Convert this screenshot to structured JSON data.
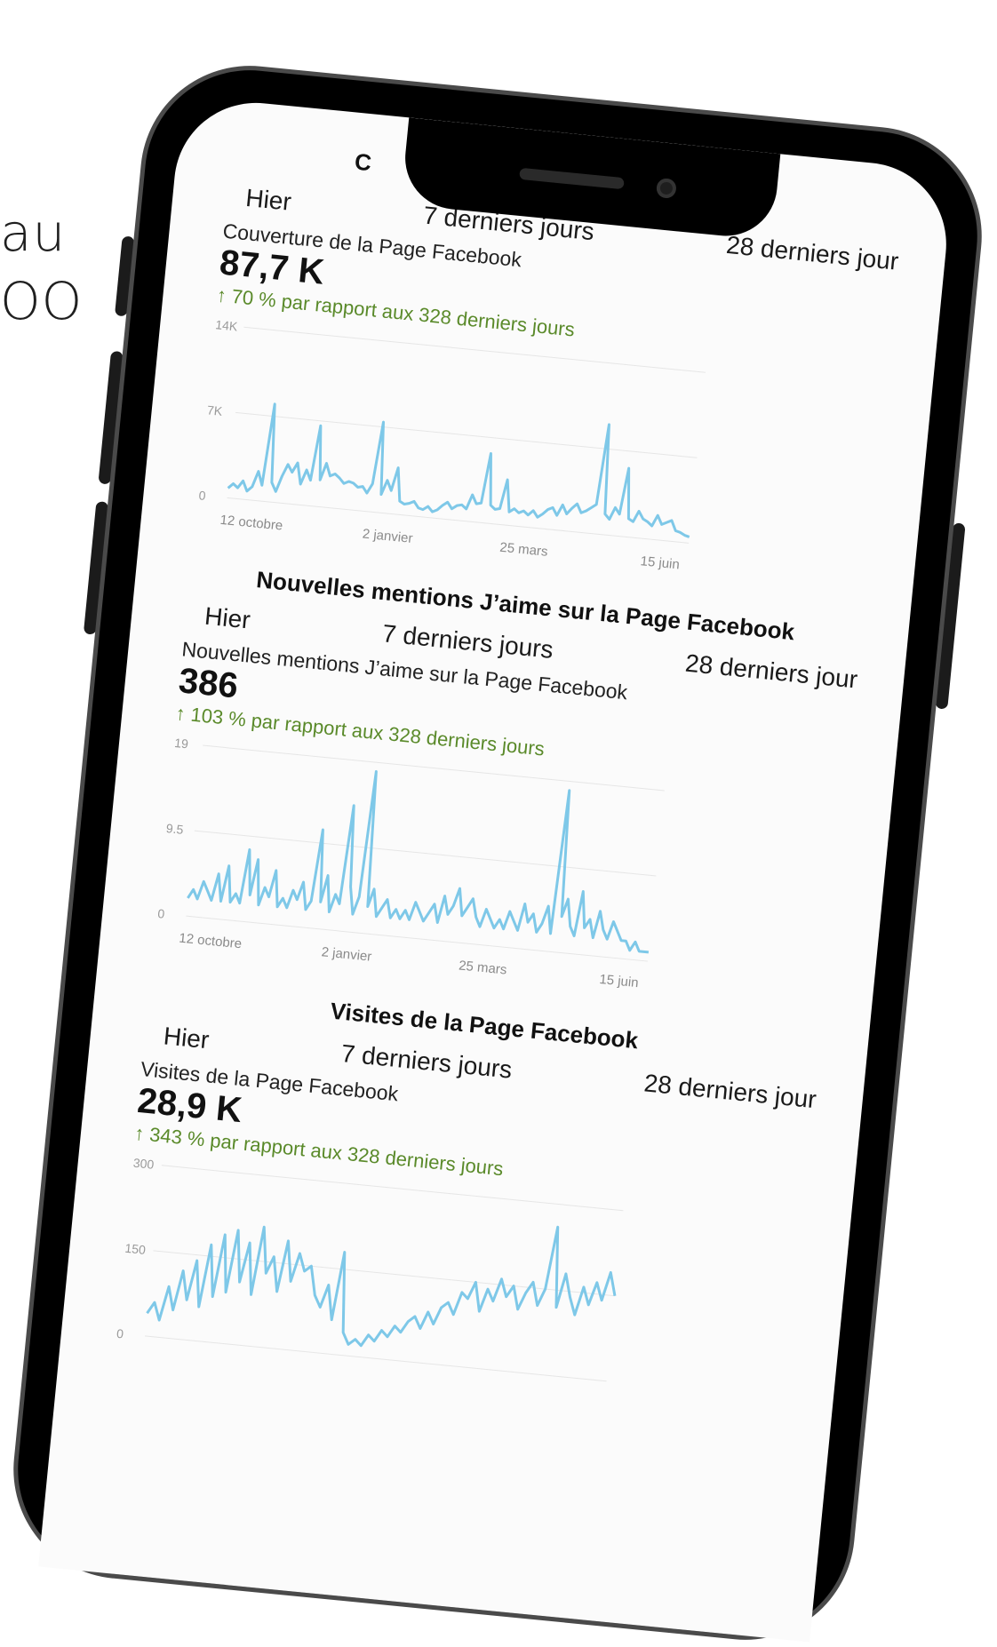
{
  "background": {
    "line1": "au",
    "line2": "OO"
  },
  "top_partial_title": "C",
  "sections": [
    {
      "title": "",
      "tabs": [
        "Hier",
        "7 derniers jours",
        "28 derniers jour"
      ],
      "metric_label": "Couverture de la Page Facebook",
      "metric_value": "87,7 K",
      "delta": "↑ 70 % par rapport aux 328 derniers jours",
      "chart_data": {
        "type": "line",
        "yticks": [
          "14K",
          "7K",
          "0"
        ],
        "ylim": [
          0,
          14000
        ],
        "xticks": [
          "12 octobre",
          "2 janvier",
          "25 mars",
          "15 juin"
        ],
        "color": "#7ec8e8",
        "values": [
          800,
          1200,
          900,
          1500,
          700,
          1100,
          2400,
          1300,
          8000,
          1600,
          900,
          2200,
          3200,
          2600,
          3400,
          1700,
          2900,
          2100,
          6600,
          2200,
          3600,
          2600,
          2800,
          2500,
          2100,
          2300,
          2200,
          1900,
          2000,
          1500,
          2300,
          7400,
          1500,
          2700,
          1900,
          3800,
          1100,
          900,
          1000,
          1200,
          700,
          600,
          900,
          500,
          700,
          1100,
          1400,
          900,
          1200,
          1300,
          1000,
          2200,
          1500,
          1600,
          5700,
          1500,
          1200,
          1300,
          3700,
          1100,
          1400,
          1100,
          1300,
          1000,
          1400,
          900,
          1200,
          1600,
          1800,
          1200,
          2100,
          1400,
          1900,
          2300,
          1600,
          1800,
          2100,
          2400,
          9000,
          1700,
          1300,
          2300,
          1800,
          5600,
          1500,
          1300,
          2200,
          1600,
          1400,
          1100,
          2000,
          1300,
          1500,
          1700,
          900,
          800,
          600,
          500
        ]
      }
    },
    {
      "title": "Nouvelles mentions J’aime sur la Page Facebook",
      "tabs": [
        "Hier",
        "7 derniers jours",
        "28 derniers jour"
      ],
      "metric_label": "Nouvelles mentions J’aime sur la Page Facebook",
      "metric_value": "386",
      "delta": "↑ 103 % par rapport aux 328 derniers jours",
      "chart_data": {
        "type": "line",
        "yticks": [
          "19",
          "9.5",
          "0"
        ],
        "ylim": [
          0,
          19
        ],
        "xticks": [
          "12 octobre",
          "2 janvier",
          "25 mars",
          "15 juin"
        ],
        "color": "#7ec8e8",
        "values": [
          2,
          3,
          2,
          4,
          3,
          2,
          5,
          2,
          6,
          2,
          3,
          2,
          8,
          3,
          7,
          2,
          4,
          3,
          6,
          2,
          3,
          2,
          4,
          3,
          5,
          2,
          3,
          11,
          3,
          6,
          2,
          4,
          3,
          14,
          5,
          2,
          4,
          18,
          3,
          5,
          2,
          3,
          4,
          2,
          3,
          2,
          3,
          2,
          4,
          3,
          2,
          3,
          4,
          2,
          5,
          3,
          4,
          6,
          3,
          4,
          5,
          3,
          2,
          4,
          3,
          2,
          3,
          2,
          4,
          3,
          2,
          5,
          3,
          4,
          2,
          3,
          5,
          2,
          18,
          4,
          6,
          3,
          2,
          7,
          3,
          4,
          2,
          5,
          3,
          2,
          4,
          3,
          2,
          2,
          1,
          2,
          1,
          1,
          1
        ]
      }
    },
    {
      "title": "Visites de la Page Facebook",
      "tabs": [
        "Hier",
        "7 derniers jours",
        "28 derniers jour"
      ],
      "metric_label": "Visites de la Page Facebook",
      "metric_value": "28,9 K",
      "delta": "↑ 343 % par rapport aux 328 derniers jours",
      "chart_data": {
        "type": "line",
        "yticks": [
          "300",
          "150",
          "0"
        ],
        "ylim": [
          0,
          300
        ],
        "xticks": [],
        "color": "#7ec8e8",
        "values": [
          40,
          60,
          30,
          90,
          50,
          120,
          70,
          140,
          60,
          170,
          80,
          190,
          90,
          200,
          110,
          180,
          90,
          210,
          130,
          160,
          100,
          190,
          120,
          170,
          140,
          150,
          100,
          80,
          120,
          60,
          180,
          40,
          20,
          30,
          20,
          40,
          30,
          50,
          40,
          60,
          50,
          70,
          80,
          60,
          90,
          70,
          100,
          110,
          90,
          130,
          120,
          150,
          100,
          140,
          120,
          160,
          130,
          150,
          110,
          140,
          160,
          120,
          150,
          260,
          120,
          180,
          140,
          110,
          160,
          130,
          170,
          140,
          190,
          150
        ]
      }
    }
  ]
}
